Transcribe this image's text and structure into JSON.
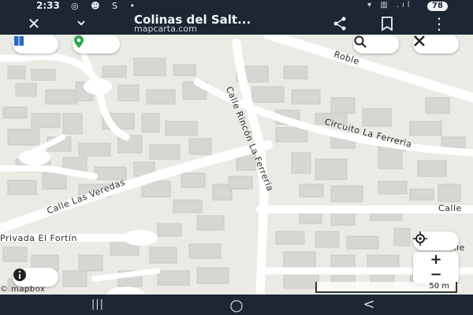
{
  "status_bar": {
    "time": "2:33",
    "left_icons": "◎ ☻ S •",
    "right_icons": "▾ ▥ .ıl",
    "battery": "78"
  },
  "header": {
    "title": "Colinas del Salt...",
    "subtitle": "mapcarta.com",
    "close_glyph": "✕",
    "expand_glyph": "⌄",
    "share_glyph": "⋖",
    "bookmark_glyph": "▭",
    "menu_glyph": "⋮"
  },
  "map": {
    "search_glyph": "⌕",
    "close_glyph": "✕",
    "info_glyph": "i",
    "locate_glyph": "◎",
    "zoom_in": "+",
    "zoom_out": "−",
    "attribution": "© mapbox",
    "scale_label": "50 m",
    "labels": {
      "roble": "Roble",
      "calle_rincon": "Calle Rincón La Ferreria",
      "circuito": "Circuito La Ferreria",
      "calle_veredas": "Calle Las Veredas",
      "privada_fortin": "Privada El Fortín",
      "calle_right_top": "Calle",
      "calle_right_bottom": "Calle"
    }
  },
  "nav_bar": {
    "recents": "|||",
    "home": "○",
    "back": "<"
  },
  "colors": {
    "chrome_bg": "#1d2733",
    "map_bg": "#ebebe6",
    "building": "#d4d4d0",
    "road": "#ffffff",
    "flag_blue": "#2a66c8",
    "pin_green": "#2aa84a"
  }
}
